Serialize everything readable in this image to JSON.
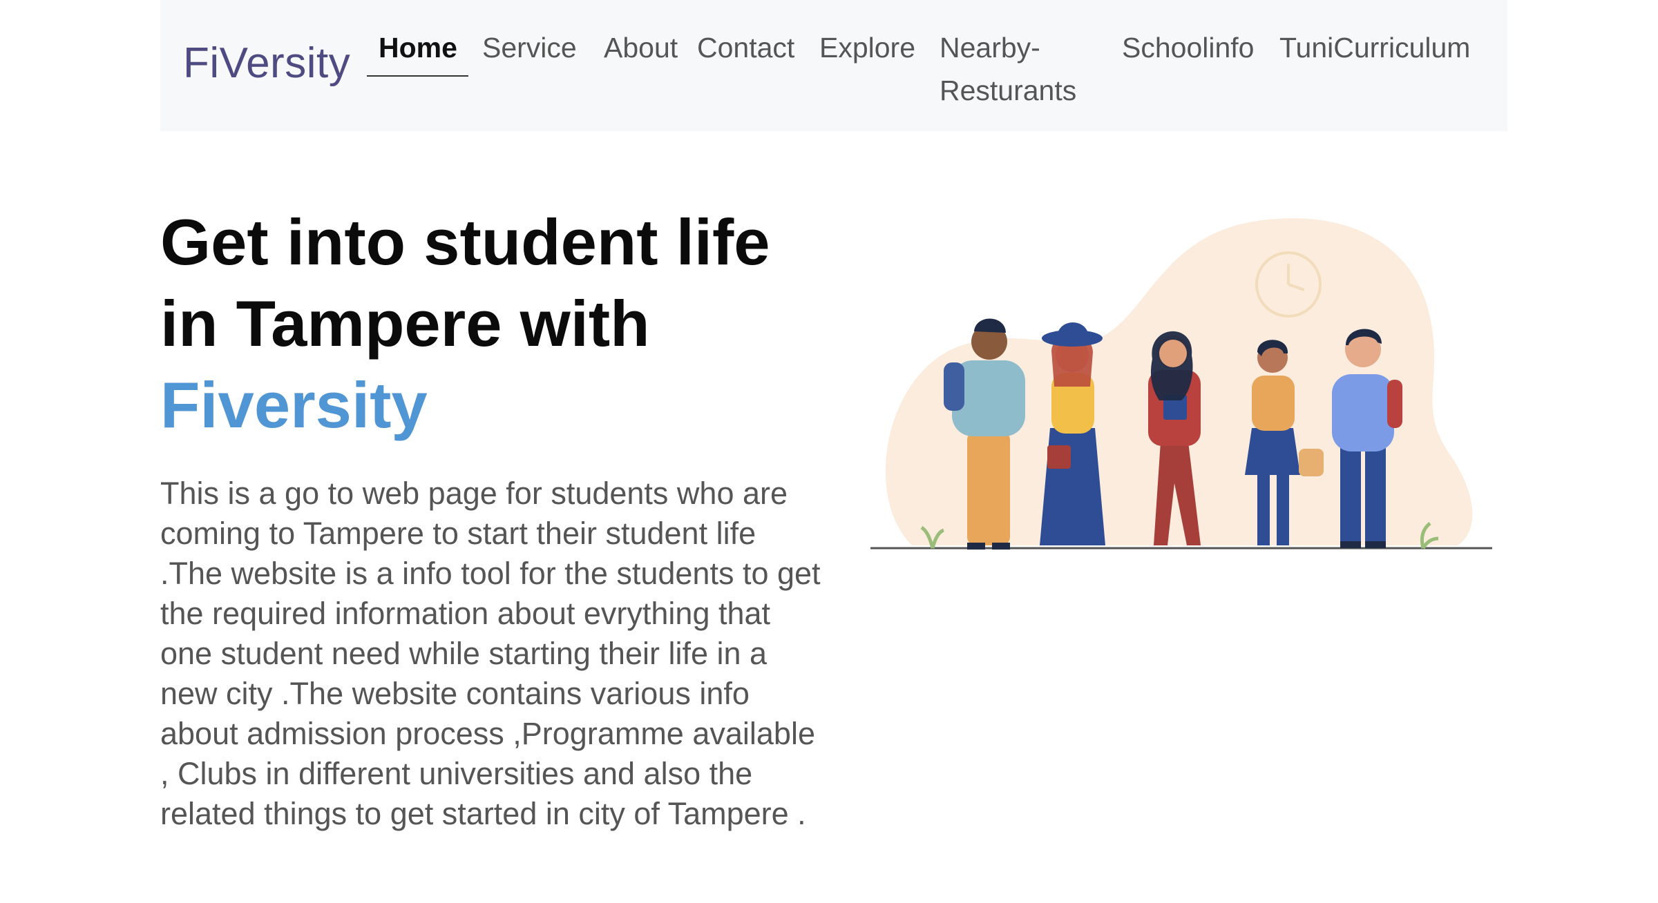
{
  "navbar": {
    "brand": "FiVersity",
    "links": [
      {
        "label": "Home",
        "active": true
      },
      {
        "label": "Service",
        "active": false
      },
      {
        "label": "About",
        "active": false
      },
      {
        "label": "Contact",
        "active": false
      },
      {
        "label": "Explore",
        "active": false
      },
      {
        "label": "Nearby-",
        "label2": "Resturants",
        "active": false
      },
      {
        "label": "Schoolinfo",
        "active": false
      },
      {
        "label": "TuniCurriculum",
        "active": false
      }
    ]
  },
  "hero": {
    "title_line1": "Get into student life",
    "title_line2": "in Tampere with",
    "title_accent": "Fiversity",
    "description": "This is a go to web page for students who are coming to Tampere to start their student life .The website is a info tool for the students to get the required information about evrything that one student need while starting their life in a new city .The website contains various info about admission process ,Programme available , Clubs in different universities and also the related things to get started in city of Tampere ."
  },
  "illustration": {
    "subject": "group-of-five-students-illustration",
    "colors": {
      "blob": "#fbecdd",
      "ground": "#555555",
      "clock": "#f3dcbc"
    }
  }
}
